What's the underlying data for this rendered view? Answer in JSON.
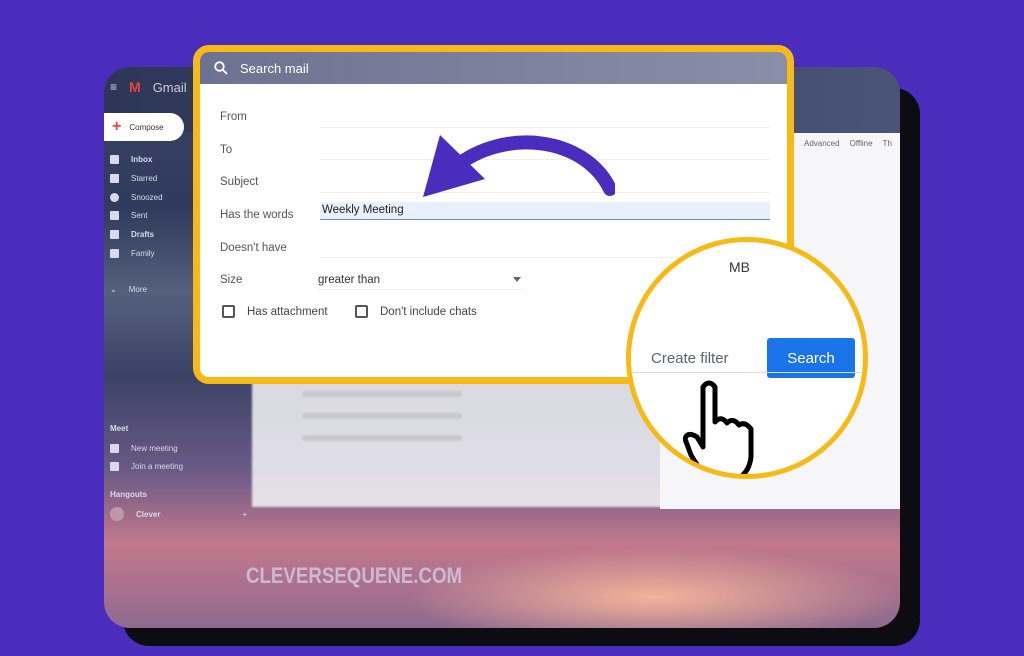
{
  "gmail": {
    "app_name": "Gmail",
    "compose": "Compose",
    "nav": [
      {
        "label": "Inbox",
        "icon": "inbox-icon"
      },
      {
        "label": "Starred",
        "icon": "star-icon"
      },
      {
        "label": "Snoozed",
        "icon": "clock-icon"
      },
      {
        "label": "Sent",
        "icon": "send-icon"
      },
      {
        "label": "Drafts",
        "icon": "draft-icon"
      },
      {
        "label": "Family",
        "icon": "label-icon"
      },
      {
        "label": "More",
        "icon": "chevron-down-icon"
      }
    ],
    "meet": {
      "title": "Meet",
      "new_meeting": "New meeting",
      "join": "Join a meeting"
    },
    "hangouts": {
      "title": "Hangouts",
      "user": "Clever"
    },
    "tabs": [
      "Advanced",
      "Offline",
      "Th"
    ]
  },
  "search": {
    "placeholder": "Search mail",
    "fields": {
      "from": "From",
      "to": "To",
      "subject": "Subject",
      "has_words": "Has the words",
      "doesnt_have": "Doesn't have",
      "size": "Size"
    },
    "has_words_value": "Weekly Meeting",
    "size_option": "greater than",
    "size_unit": "MB",
    "has_attachment": "Has attachment",
    "dont_include_chats": "Don't include chats",
    "create_filter": "Create filter",
    "search_button": "Search"
  },
  "watermark": "CLEVERSEQUENE.COM",
  "colors": {
    "background": "#4a2dbd",
    "highlight": "#f7b916",
    "arrow": "#4a2dbd",
    "search_button": "#1a73e8"
  }
}
